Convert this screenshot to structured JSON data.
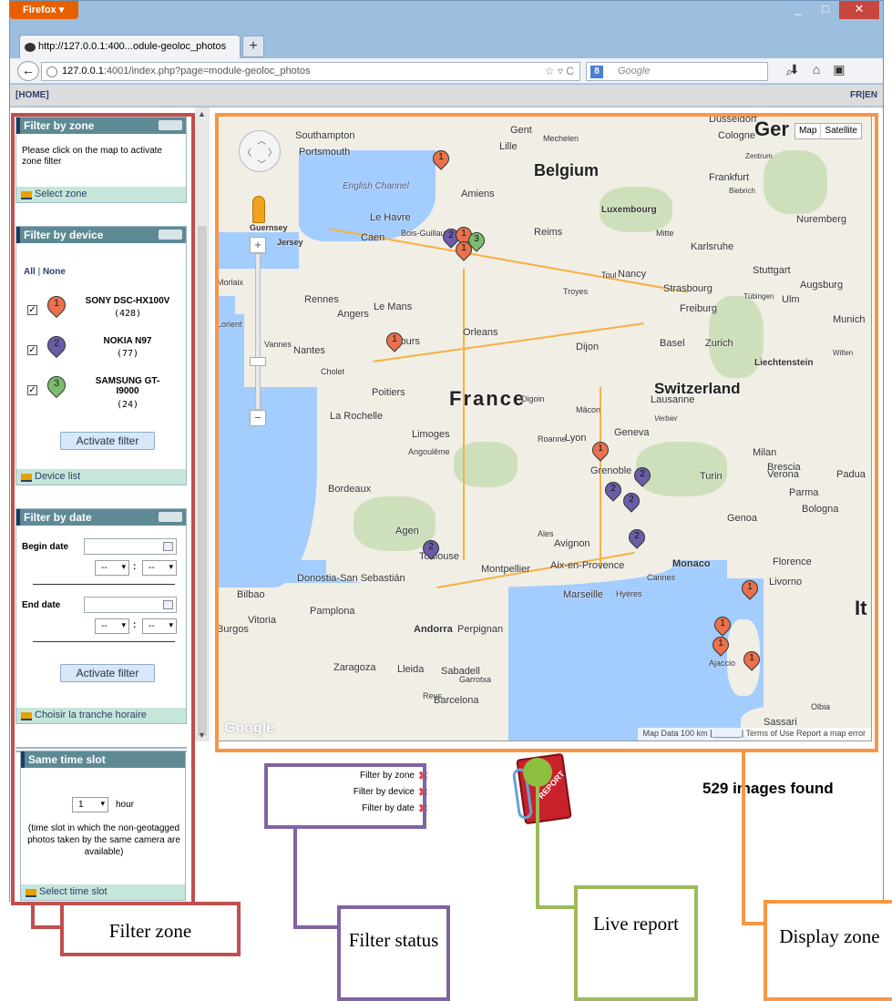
{
  "browser": {
    "app_button": "Firefox",
    "tab_title": "http://127.0.0.1:400...odule-geoloc_photos",
    "new_tab": "+",
    "url_host": "127.0.0.1",
    "url_rest": ":4001/index.php?page=module-geoloc_photos",
    "search_placeholder": "Google",
    "controls": {
      "minimize": "_",
      "maximize": "□",
      "close": "✕"
    }
  },
  "site": {
    "home_link": "[HOME]",
    "lang_switch": "FR|EN"
  },
  "filters": {
    "zone": {
      "title": "Filter by zone",
      "instructions": "Please click on the map to activate zone filter",
      "footer": "Select zone"
    },
    "device": {
      "title": "Filter by device",
      "all": "All",
      "separator": "|",
      "none": "None",
      "devices": [
        {
          "pin": "1",
          "name": "SONY DSC-HX100V",
          "count": "(428)",
          "color": "#e9724c",
          "checked": true
        },
        {
          "pin": "2",
          "name": "NOKIA N97",
          "count": "(77)",
          "color": "#6b5ca7",
          "checked": true
        },
        {
          "pin": "3",
          "name": "SAMSUNG GT-I9000",
          "count": "(24)",
          "color": "#7dbb6e",
          "checked": true
        }
      ],
      "button": "Activate filter",
      "footer": "Device list"
    },
    "date": {
      "title": "Filter by date",
      "begin_label": "Begin date",
      "end_label": "End date",
      "hour_placeholder": "--",
      "minute_placeholder": "--",
      "button": "Activate filter",
      "footer": "Choisir la tranche horaire"
    },
    "timeslot": {
      "title": "Same time slot",
      "value": "1",
      "unit": "hour",
      "description": "(time slot in which the non-geotagged photos taken by the same camera are available)",
      "footer": "Select time slot"
    }
  },
  "map": {
    "type_buttons": {
      "map": "Map",
      "satellite": "Satellite"
    },
    "countries": {
      "france": "France",
      "belgium": "Belgium",
      "switzerland": "Switzerland",
      "germany": "Ger",
      "italy": "It"
    },
    "cities": [
      "Southampton",
      "Portsmouth",
      "Gent",
      "Mechelen",
      "Lille",
      "Düsseldorf",
      "Cologne",
      "Frankfurt",
      "Amiens",
      "Le Havre",
      "Caen",
      "Bois-Guillaume",
      "Reims",
      "Luxembourg",
      "Mitte",
      "Karlsruhe",
      "Nuremberg",
      "Rennes",
      "Le Mans",
      "Toul",
      "Nancy",
      "Stuttgart",
      "Strasbourg",
      "Augsburg",
      "Ulm",
      "Orleans",
      "Freiburg",
      "Munich",
      "Angers",
      "Tours",
      "Nantes",
      "Cholet",
      "Dijon",
      "Basel",
      "Zurich",
      "Liechtenstein",
      "Poitiers",
      "Lausanne",
      "La Rochelle",
      "Limoges",
      "Geneva",
      "Lyon",
      "Angoulême",
      "Grenoble",
      "Turin",
      "Milan",
      "Bordeaux",
      "Agen",
      "Toulouse",
      "Montpellier",
      "Avignon",
      "Aix-en-Provence",
      "Monaco",
      "Genoa",
      "Bologna",
      "Parma",
      "Florence",
      "Livorno",
      "Marseille",
      "Hyères",
      "Cannes",
      "Donostia-San Sebastián",
      "Bilbao",
      "Pamplona",
      "Vitoria",
      "Andorra",
      "Perpignan",
      "Zaragoza",
      "Lleida",
      "Sabadell",
      "Reus",
      "Barcelona",
      "Ajaccio",
      "Sassari",
      "Olbia",
      "Guernsey",
      "Jersey",
      "Morlaix",
      "Lorient",
      "Vannes",
      "Troyes",
      "Roanne",
      "Mâcon",
      "Digoin",
      "Brescia",
      "Verona",
      "Padua",
      "English Channel",
      "Garrotxa",
      "Biebrich",
      "Zentrum",
      "Tübingen",
      "Wilten",
      "Verbier",
      "Ales",
      "Burgos"
    ],
    "markers": [
      {
        "num": "1",
        "color": "#e9724c"
      },
      {
        "num": "2",
        "color": "#6b5ca7"
      },
      {
        "num": "1",
        "color": "#e9724c"
      },
      {
        "num": "3",
        "color": "#7dbb6e"
      },
      {
        "num": "1",
        "color": "#e9724c"
      },
      {
        "num": "1",
        "color": "#e9724c"
      },
      {
        "num": "1",
        "color": "#e9724c"
      },
      {
        "num": "2",
        "color": "#6b5ca7"
      },
      {
        "num": "2",
        "color": "#6b5ca7"
      },
      {
        "num": "2",
        "color": "#6b5ca7"
      },
      {
        "num": "2",
        "color": "#6b5ca7"
      },
      {
        "num": "2",
        "color": "#6b5ca7"
      },
      {
        "num": "1",
        "color": "#e9724c"
      },
      {
        "num": "1",
        "color": "#e9724c"
      },
      {
        "num": "1",
        "color": "#e9724c"
      },
      {
        "num": "1",
        "color": "#e9724c"
      }
    ],
    "google_logo": "Google",
    "footer": "Map Data  100 km ⌊______⌋  Terms of Use  Report a map error"
  },
  "filter_status": {
    "zone": "Filter by zone",
    "device": "Filter by device",
    "date": "Filter by date",
    "status_icon": "✖"
  },
  "report": {
    "icon_label": "REPORT"
  },
  "results": {
    "found_text": "529 images found"
  },
  "annotations": {
    "filter_zone": {
      "label": "Filter zone",
      "color": "#c0504d"
    },
    "filter_status": {
      "label": "Filter status",
      "color": "#8064a2"
    },
    "live_report": {
      "label": "Live report",
      "color": "#9bbb59"
    },
    "display_zone": {
      "label": "Display zone",
      "color": "#f79646"
    }
  }
}
